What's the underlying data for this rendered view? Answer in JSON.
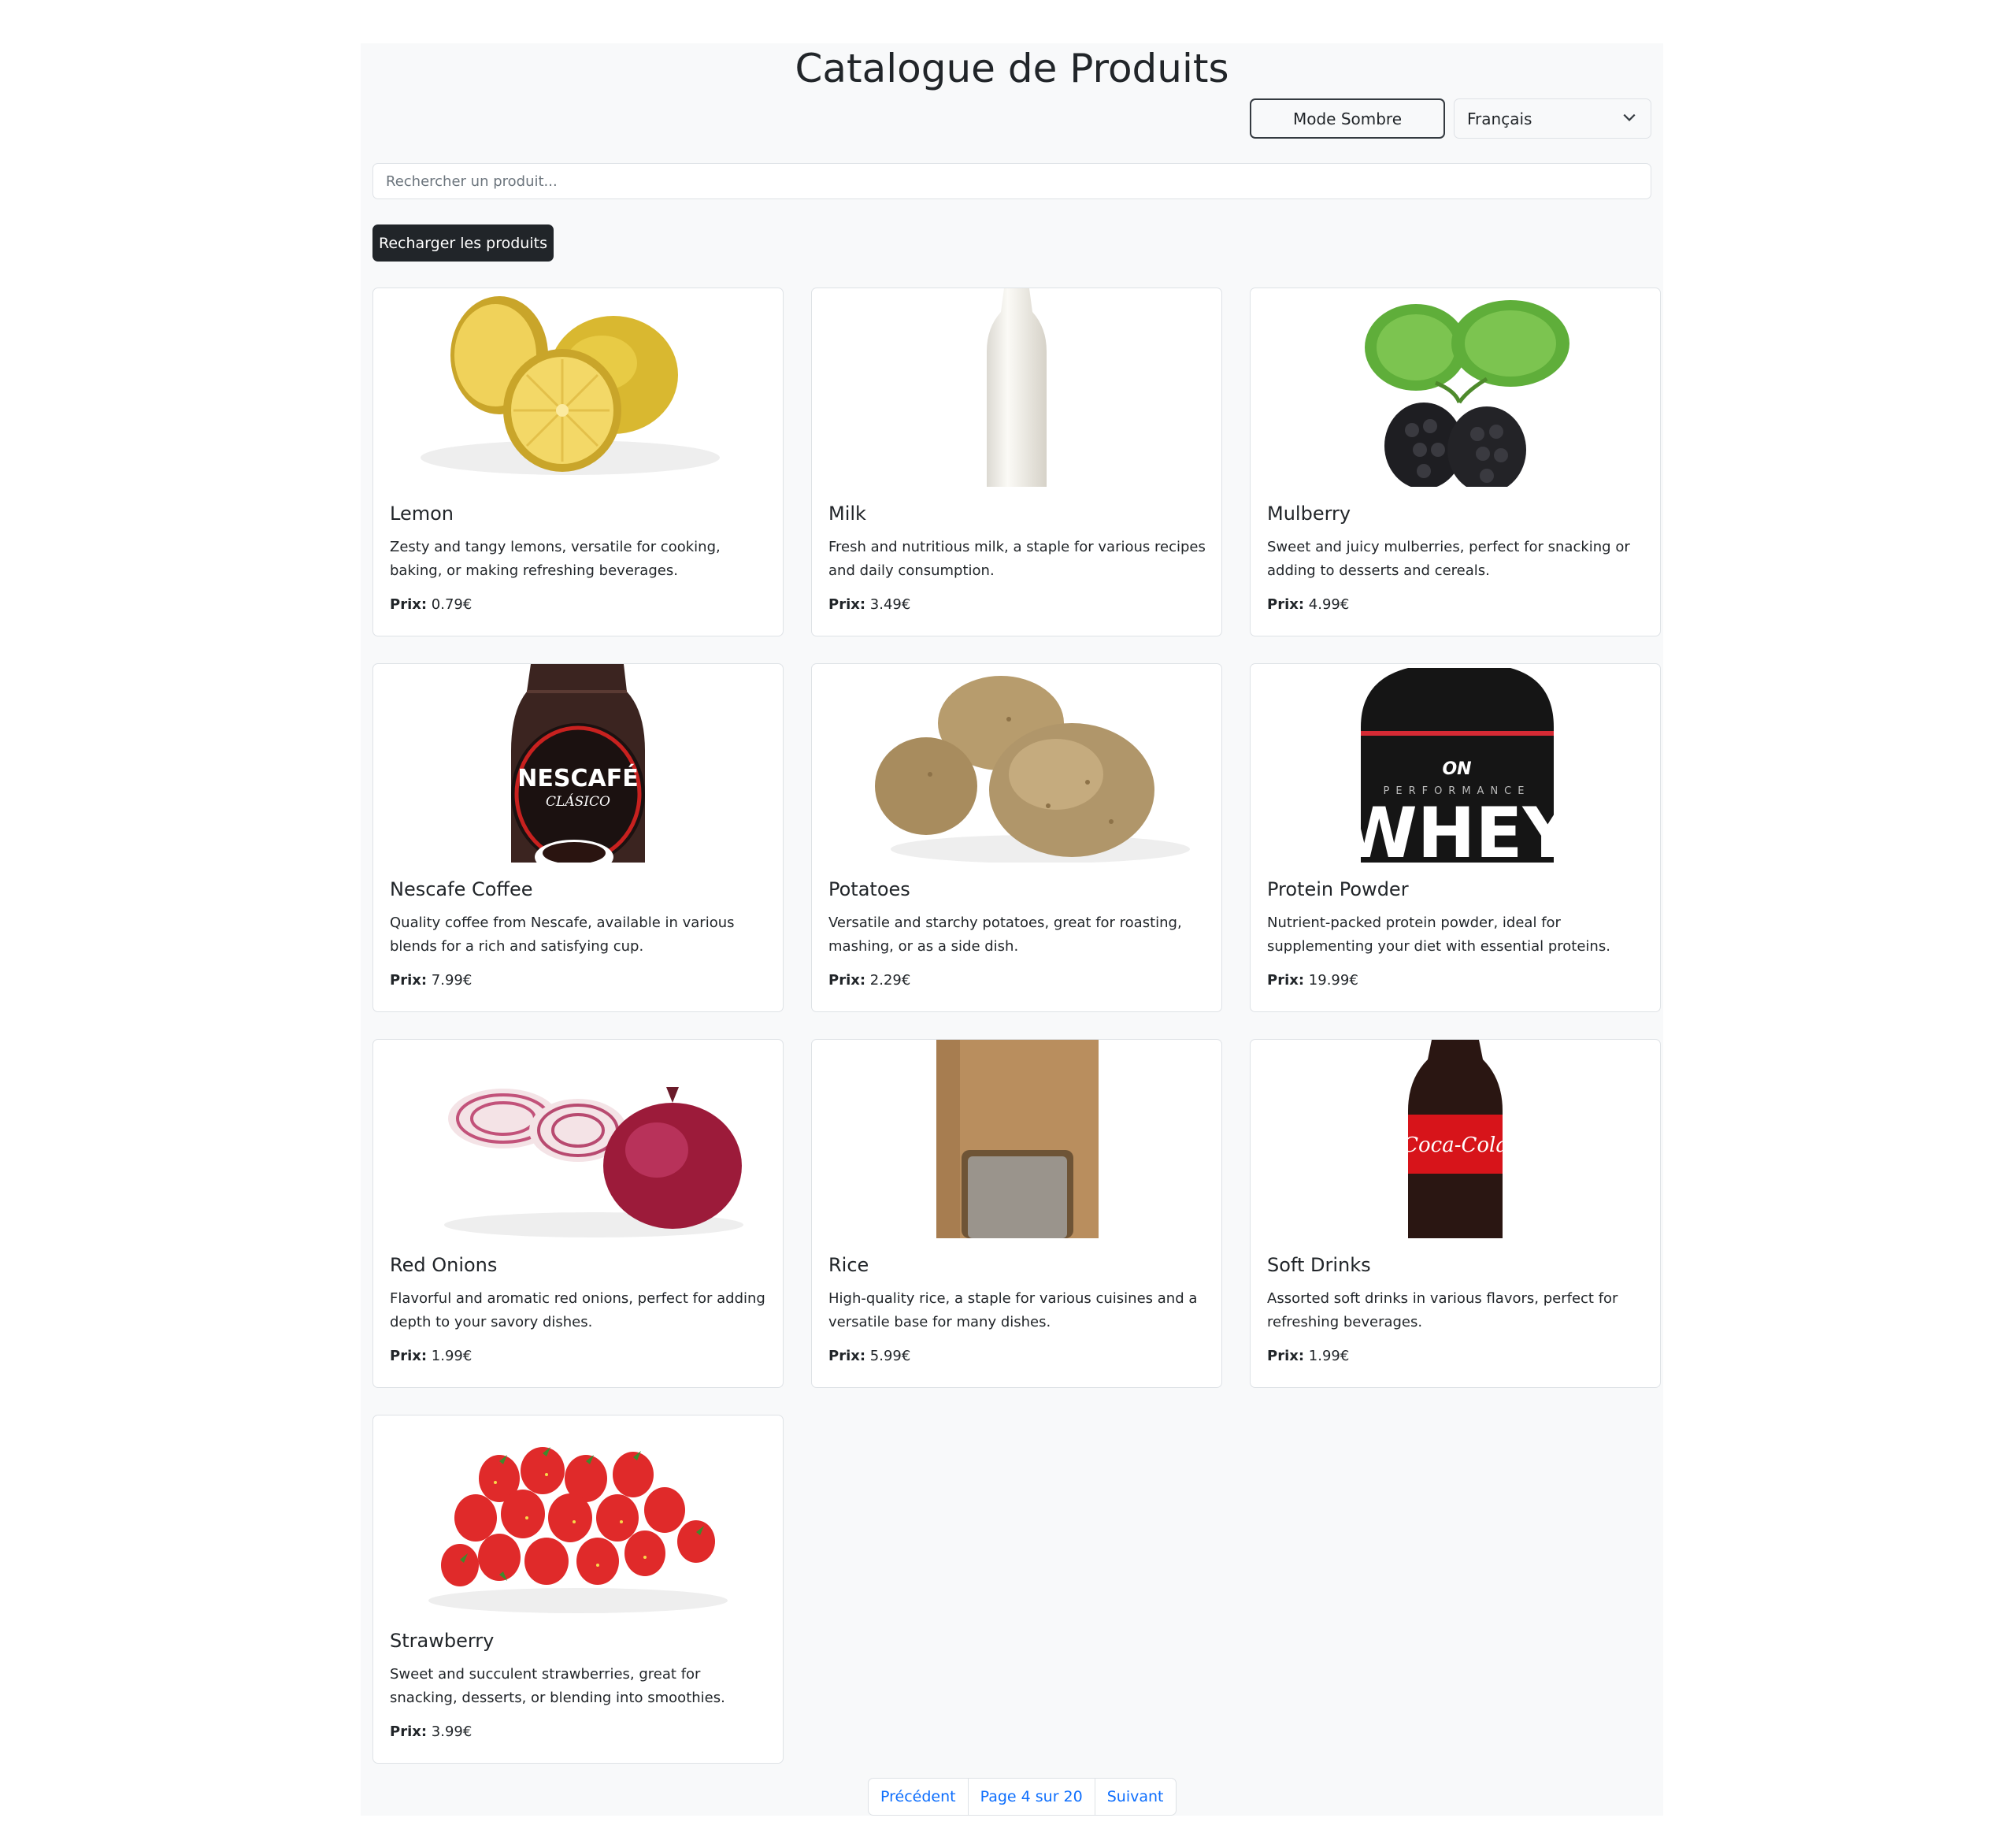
{
  "header": {
    "title": "Catalogue de Produits"
  },
  "controls": {
    "mode_label": "Mode Sombre",
    "language": "Français",
    "search_placeholder": "Rechercher un produit...",
    "reload_label": "Recharger les produits"
  },
  "price_label": "Prix:",
  "products": [
    {
      "name": "Lemon",
      "description": "Zesty and tangy lemons, versatile for cooking, baking, or making refreshing beverages.",
      "price": "0.79€",
      "icon": "lemon-image"
    },
    {
      "name": "Milk",
      "description": "Fresh and nutritious milk, a staple for various recipes and daily consumption.",
      "price": "3.49€",
      "icon": "milk-bottle-image"
    },
    {
      "name": "Mulberry",
      "description": "Sweet and juicy mulberries, perfect for snacking or adding to desserts and cereals.",
      "price": "4.99€",
      "icon": "mulberry-image"
    },
    {
      "name": "Nescafe Coffee",
      "description": "Quality coffee from Nescafe, available in various blends for a rich and satisfying cup.",
      "price": "7.99€",
      "icon": "coffee-jar-image"
    },
    {
      "name": "Potatoes",
      "description": "Versatile and starchy potatoes, great for roasting, mashing, or as a side dish.",
      "price": "2.29€",
      "icon": "potatoes-image"
    },
    {
      "name": "Protein Powder",
      "description": "Nutrient-packed protein powder, ideal for supplementing your diet with essential proteins.",
      "price": "19.99€",
      "icon": "protein-tub-image"
    },
    {
      "name": "Red Onions",
      "description": "Flavorful and aromatic red onions, perfect for adding depth to your savory dishes.",
      "price": "1.99€",
      "icon": "red-onion-image"
    },
    {
      "name": "Rice",
      "description": "High-quality rice, a staple for various cuisines and a versatile base for many dishes.",
      "price": "5.99€",
      "icon": "rice-bag-image"
    },
    {
      "name": "Soft Drinks",
      "description": "Assorted soft drinks in various flavors, perfect for refreshing beverages.",
      "price": "1.99€",
      "icon": "soda-bottle-image"
    },
    {
      "name": "Strawberry",
      "description": "Sweet and succulent strawberries, great for snacking, desserts, or blending into smoothies.",
      "price": "3.99€",
      "icon": "strawberries-image"
    }
  ],
  "image_text": {
    "nescafe": "NESCAFÉ",
    "nescafe_sub": "CLÁSICO",
    "whey_brand": "ON",
    "whey_sub": "PERFORMANCE",
    "whey": "WHEY",
    "coke": "Coca-Cola"
  },
  "pagination": {
    "prev": "Précédent",
    "page": "Page 4 sur 20",
    "next": "Suivant"
  },
  "colors": {
    "page_bg": "#f8f9fa",
    "dark_button": "#212529",
    "link": "#0d6efd",
    "border": "#dee2e6"
  }
}
